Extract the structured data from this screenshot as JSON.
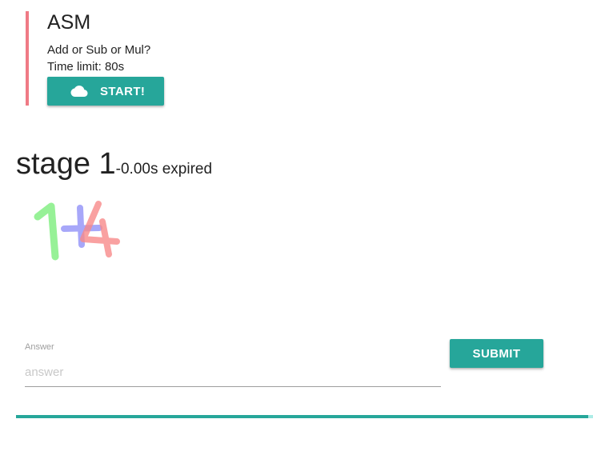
{
  "challenge": {
    "title": "ASM",
    "description": "Add or Sub or Mul?",
    "time_limit": "Time limit: 80s",
    "start_label": "START!",
    "start_icon": "cloud-icon",
    "accent_color": "#ef7a85"
  },
  "stage": {
    "title": "stage 1",
    "timer": "-0.00s expired"
  },
  "captcha": {
    "text": "1+4",
    "colors": {
      "digit_1": "#8cf08c",
      "operator": "#8a8af8",
      "digit_2": "#f88a8a"
    }
  },
  "answer": {
    "label": "Answer",
    "placeholder": "answer",
    "value": ""
  },
  "submit": {
    "label": "SUBMIT"
  },
  "progress": {
    "fraction": 0.992
  },
  "colors": {
    "primary": "#26a69a",
    "progress_track": "#acece6"
  }
}
